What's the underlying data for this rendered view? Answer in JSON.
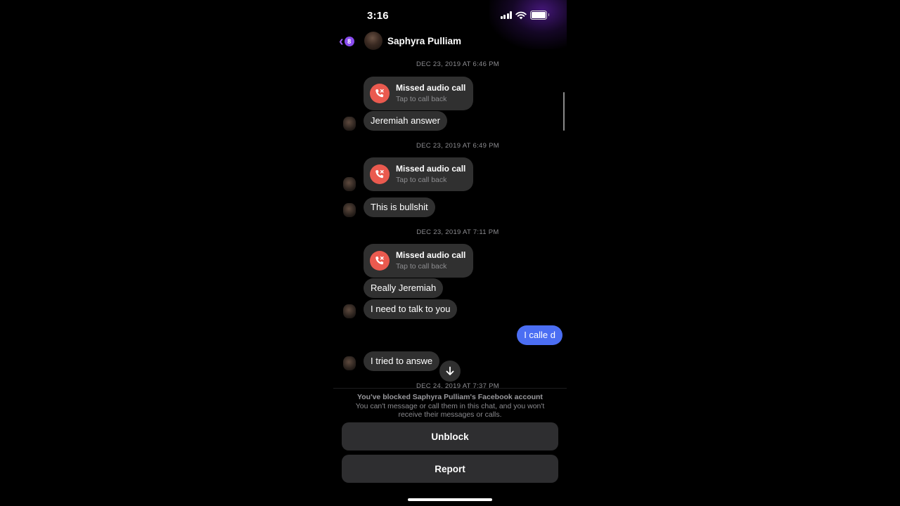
{
  "status_bar": {
    "time": "3:16",
    "icons": [
      "cellular-signal-icon",
      "wifi-icon",
      "battery-icon"
    ]
  },
  "header": {
    "back_badge_count": "8",
    "contact_name": "Saphyra Pulliam",
    "back_icon": "chevron-left-icon"
  },
  "messages": [
    {
      "type": "timestamp",
      "text": "DEC 23, 2019 AT 6:46 PM"
    },
    {
      "type": "missed_call",
      "title": "Missed audio call",
      "subtitle": "Tap to call back"
    },
    {
      "type": "incoming",
      "text": "Jeremiah answer"
    },
    {
      "type": "timestamp",
      "text": "DEC 23, 2019 AT 6:49 PM"
    },
    {
      "type": "missed_call",
      "title": "Missed audio call",
      "subtitle": "Tap to call back"
    },
    {
      "type": "incoming",
      "text": "This is bullshit"
    },
    {
      "type": "timestamp",
      "text": "DEC 23, 2019 AT 7:11 PM"
    },
    {
      "type": "missed_call",
      "title": "Missed audio call",
      "subtitle": "Tap to call back"
    },
    {
      "type": "incoming",
      "text": "Really Jeremiah"
    },
    {
      "type": "incoming",
      "text": "I need to talk to you"
    },
    {
      "type": "outgoing",
      "text": "I calle d"
    },
    {
      "type": "incoming",
      "text": "I tried to answe"
    },
    {
      "type": "timestamp",
      "text": "DEC 24, 2019 AT 7:37 PM"
    }
  ],
  "colors": {
    "outgoing_bubble": "#4b6ef3",
    "incoming_bubble": "#303030",
    "missed_call": "#ea5a4f",
    "accent": "#8a4cf0"
  },
  "blocked_notice": {
    "title": "You've blocked Saphyra Pulliam's Facebook account",
    "subtitle": "You can't message or call them in this chat, and you won't receive their messages or calls."
  },
  "actions": {
    "unblock_label": "Unblock",
    "report_label": "Report"
  }
}
